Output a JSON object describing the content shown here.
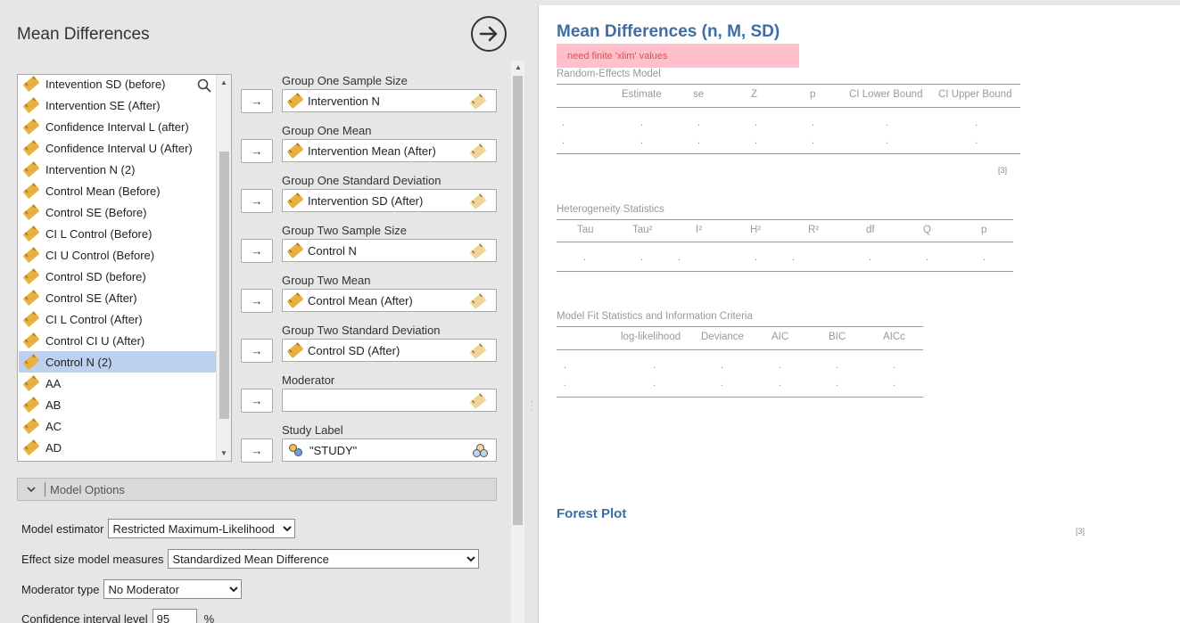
{
  "left_panel": {
    "title": "Mean Differences",
    "variables": [
      "Intevention SD (before)",
      "Intervention SE (After)",
      "Confidence Interval L (after)",
      "Confidence Interval U (After)",
      "Intervention N (2)",
      "Control Mean (Before)",
      "Control SE (Before)",
      "CI L Control (Before)",
      "CI U Control (Before)",
      "Control SD (before)",
      "Control SE (After)",
      "CI L Control (After)",
      "Control CI U (After)",
      "Control N (2)",
      "AA",
      "AB",
      "AC",
      "AD"
    ],
    "selected_variable": "Control N (2)",
    "targets": [
      {
        "label": "Group One Sample Size",
        "value": "Intervention N"
      },
      {
        "label": "Group One Mean",
        "value": "Intervention Mean (After)"
      },
      {
        "label": "Group One Standard Deviation",
        "value": "Intervention SD (After)"
      },
      {
        "label": "Group Two Sample Size",
        "value": "Control N"
      },
      {
        "label": "Group Two Mean",
        "value": "Control Mean (After)"
      },
      {
        "label": "Group Two Standard Deviation",
        "value": "Control SD (After)"
      },
      {
        "label": "Moderator",
        "value": ""
      },
      {
        "label": "Study Label",
        "value": "\"STUDY\""
      }
    ],
    "options_header": "Model Options",
    "options": {
      "model_estimator_label": "Model estimator",
      "model_estimator_value": "Restricted Maximum-Likelihood",
      "effect_size_label": "Effect size model measures",
      "effect_size_value": "Standardized Mean Difference",
      "moderator_type_label": "Moderator type",
      "moderator_type_value": "No Moderator",
      "ci_level_label": "Confidence interval level",
      "ci_level_value": "95",
      "ci_unit": "%"
    }
  },
  "results": {
    "title": "Mean Differences (n, M, SD)",
    "error": "need finite 'xlim' values",
    "random_effects": {
      "title": "Random-Effects Model",
      "headers": [
        "Estimate",
        "se",
        "Z",
        "p",
        "CI Lower Bound",
        "CI Upper Bound"
      ],
      "footnote": "[3]"
    },
    "heterogeneity": {
      "title": "Heterogeneity Statistics",
      "headers": [
        "Tau",
        "Tau²",
        "I²",
        "H²",
        "R²",
        "df",
        "Q",
        "p"
      ]
    },
    "model_fit": {
      "title": "Model Fit Statistics and Information Criteria",
      "headers": [
        "log-likelihood",
        "Deviance",
        "AIC",
        "BIC",
        "AICc"
      ]
    },
    "forest_plot": {
      "title": "Forest Plot",
      "footnote": "[3]"
    },
    "dot": "."
  },
  "colors": {
    "accent": "#3e6da6",
    "error_bg": "#ffc0cb",
    "error_text": "#d9534f",
    "selected_bg": "#bed0f0"
  }
}
